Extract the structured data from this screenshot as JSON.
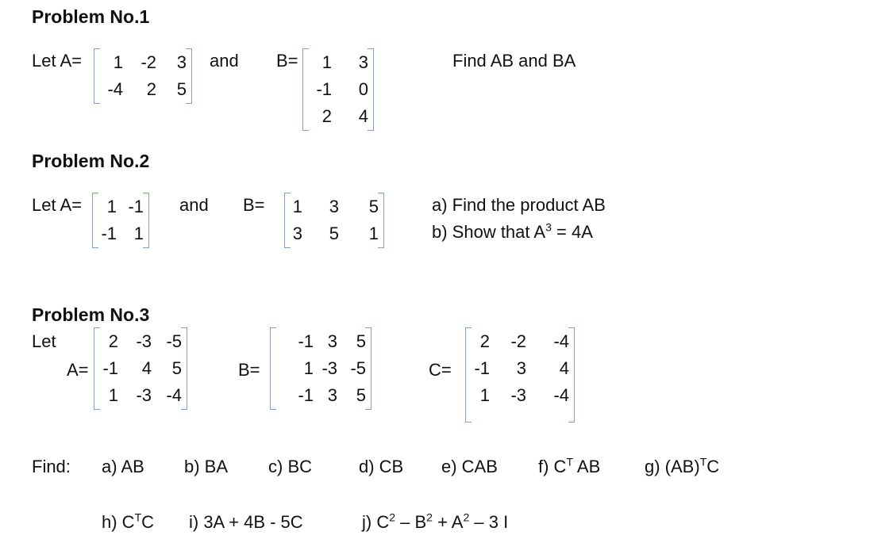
{
  "problem1": {
    "heading": "Problem No.1",
    "let_a": "Let A=",
    "and": "and",
    "b_label": "B=",
    "task": "Find  AB  and  BA",
    "A": [
      [
        "1",
        "-2",
        "3"
      ],
      [
        "-4",
        "2",
        "5"
      ]
    ],
    "B": [
      [
        "1",
        "3"
      ],
      [
        "-1",
        "0"
      ],
      [
        "2",
        "4"
      ]
    ]
  },
  "problem2": {
    "heading": "Problem No.2",
    "let_a": "Let A=",
    "and": "and",
    "b_label": "B=",
    "A": [
      [
        "1",
        "-1"
      ],
      [
        "-1",
        "1"
      ]
    ],
    "B": [
      [
        "1",
        "3",
        "5"
      ],
      [
        "3",
        "5",
        "1"
      ]
    ],
    "task_a": "a) Find the product AB",
    "task_b_prefix": "b) Show that A",
    "task_b_sup": "3",
    "task_b_suffix": " = 4A"
  },
  "problem3": {
    "heading": "Problem No.3",
    "let": "Let",
    "a_label": "A=",
    "b_label": "B=",
    "c_label": "C=",
    "A": [
      [
        "2",
        "-3",
        "-5"
      ],
      [
        "-1",
        "4",
        "5"
      ],
      [
        "1",
        "-3",
        "-4"
      ]
    ],
    "B": [
      [
        "-1",
        "3",
        "5"
      ],
      [
        "1",
        "-3",
        "-5"
      ],
      [
        "-1",
        "3",
        "5"
      ]
    ],
    "C": [
      [
        "2",
        "-2",
        "-4"
      ],
      [
        "-1",
        "3",
        "4"
      ],
      [
        "1",
        "-3",
        "-4"
      ]
    ],
    "find_label": "Find:",
    "items": {
      "a": "a) AB",
      "b": "b)  BA",
      "c": "c)  BC",
      "d": "d) CB",
      "e": "e) CAB",
      "f_prefix": "f)  C",
      "f_sup": "T",
      "f_suffix": " AB",
      "g_prefix": "g)  (AB)",
      "g_sup": "T",
      "g_suffix": "C",
      "h_prefix": "h)  C",
      "h_sup": "T",
      "h_suffix": "C",
      "i": "i)  3A  +  4B  -  5C",
      "j_prefix": "j) C",
      "j_sup1": "2",
      "j_mid1": " – B",
      "j_sup2": "2",
      "j_mid2": " + A",
      "j_sup3": "2",
      "j_suffix": " – 3 I"
    }
  }
}
